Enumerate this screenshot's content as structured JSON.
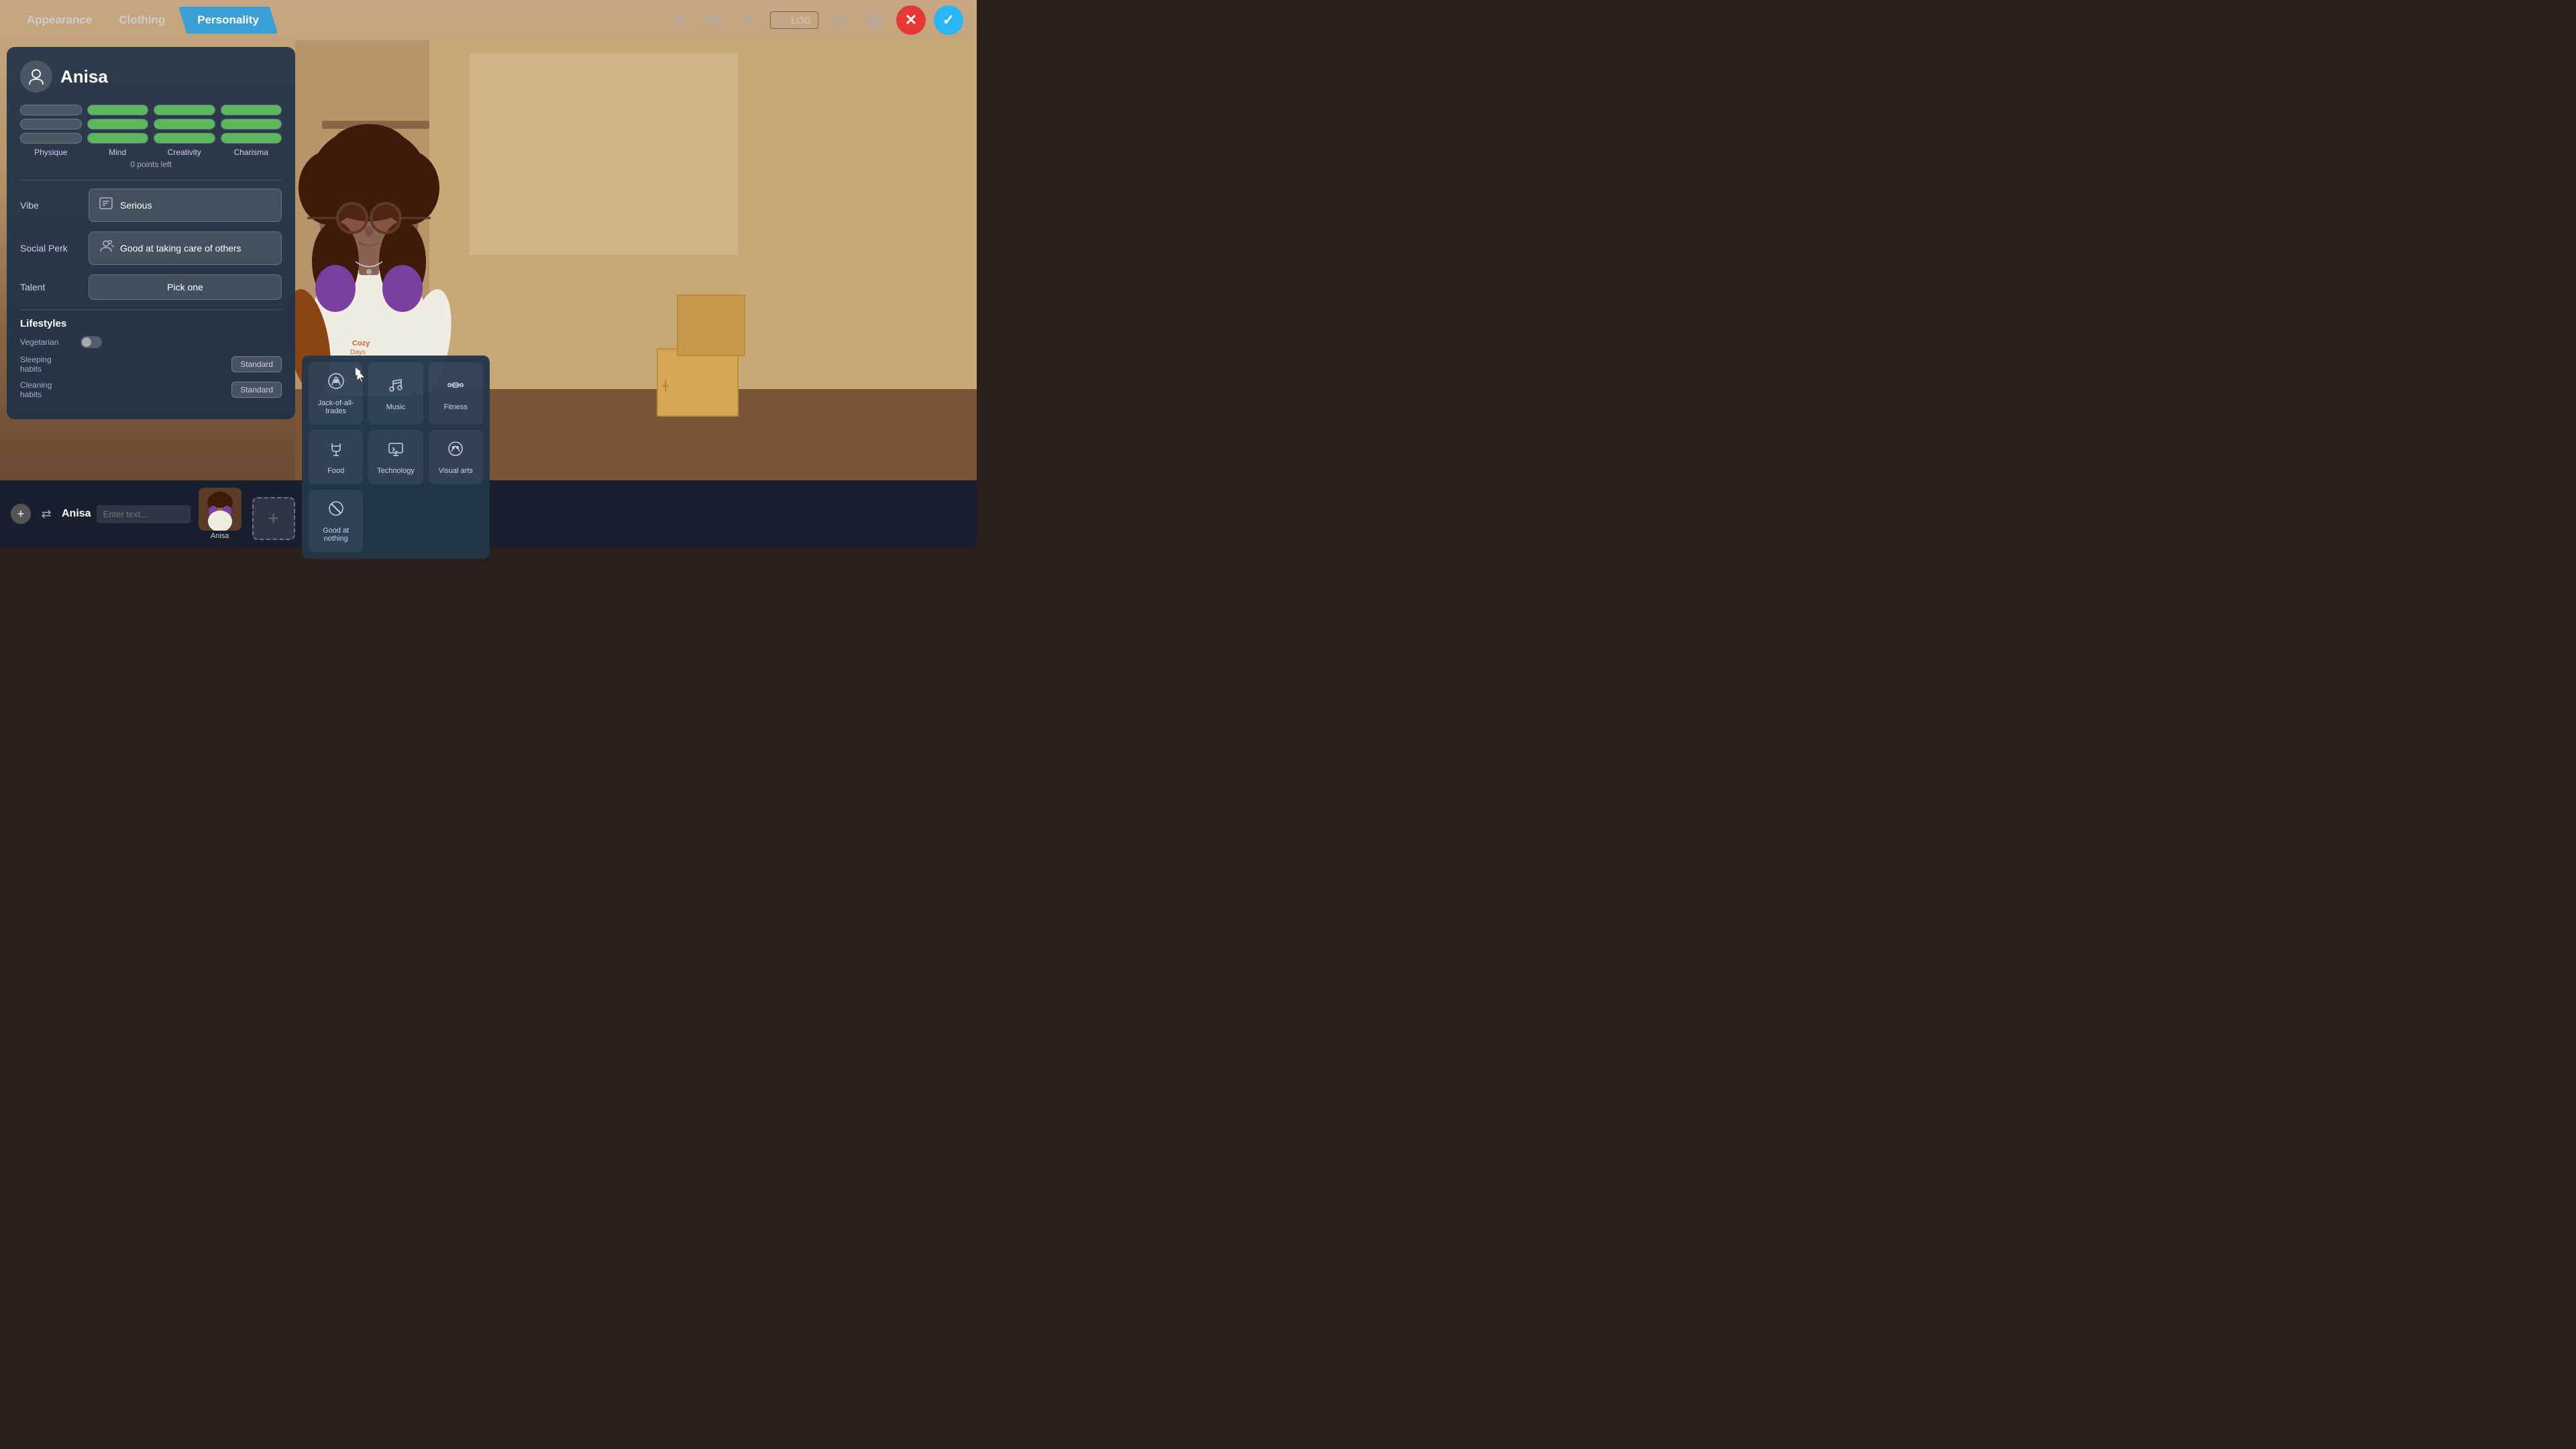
{
  "nav": {
    "tabs": [
      {
        "label": "Appearance",
        "active": false
      },
      {
        "label": "Clothing",
        "active": false
      },
      {
        "label": "Personality",
        "active": true
      }
    ],
    "icons": [
      "people-icon",
      "group-icon",
      "move-icon",
      "log-icon",
      "heart-icon",
      "play-icon"
    ],
    "log_label": "LOG",
    "cancel_label": "✕",
    "confirm_label": "✓"
  },
  "panel": {
    "character_name": "Anisa",
    "points_left": "0 points left",
    "stats": {
      "columns": [
        "Physique",
        "Mind",
        "Creativity",
        "Charisma"
      ],
      "bars_per_col": 3,
      "fills": {
        "physique": [
          0,
          0,
          0
        ],
        "mind": [
          100,
          100,
          100
        ],
        "creativity": [
          100,
          100,
          100
        ],
        "charisma": [
          100,
          100,
          100
        ]
      }
    },
    "vibe_label": "Vibe",
    "vibe_value": "Serious",
    "social_perk_label": "Social Perk",
    "social_perk_value": "Good at taking care of others",
    "talent_label": "Talent",
    "talent_value": "Pick one",
    "lifestyles_label": "Lifestyles",
    "lifestyle_items": [
      {
        "name": "Vegetarian",
        "sub": "",
        "badge": null,
        "has_toggle": true
      },
      {
        "name": "Sleeping habits",
        "sub": "",
        "badge": "Standard",
        "has_toggle": false
      },
      {
        "name": "Cleaning habits",
        "sub": "",
        "badge": "Standard",
        "has_toggle": false
      }
    ]
  },
  "talent_dropdown": {
    "items": [
      {
        "label": "Jack-of-all-trades",
        "icon": "✦"
      },
      {
        "label": "Music",
        "icon": "🎵"
      },
      {
        "label": "Fitness",
        "icon": "🏋"
      },
      {
        "label": "Food",
        "icon": "🍳"
      },
      {
        "label": "Technology",
        "icon": "💻"
      },
      {
        "label": "Visual arts",
        "icon": "🎨"
      },
      {
        "label": "Good at nothing",
        "icon": "⊘"
      }
    ]
  },
  "bottom_bar": {
    "character_name": "Anisa",
    "input_placeholder": "Enter text...",
    "add_label": "+",
    "swap_icon": "⇄"
  }
}
